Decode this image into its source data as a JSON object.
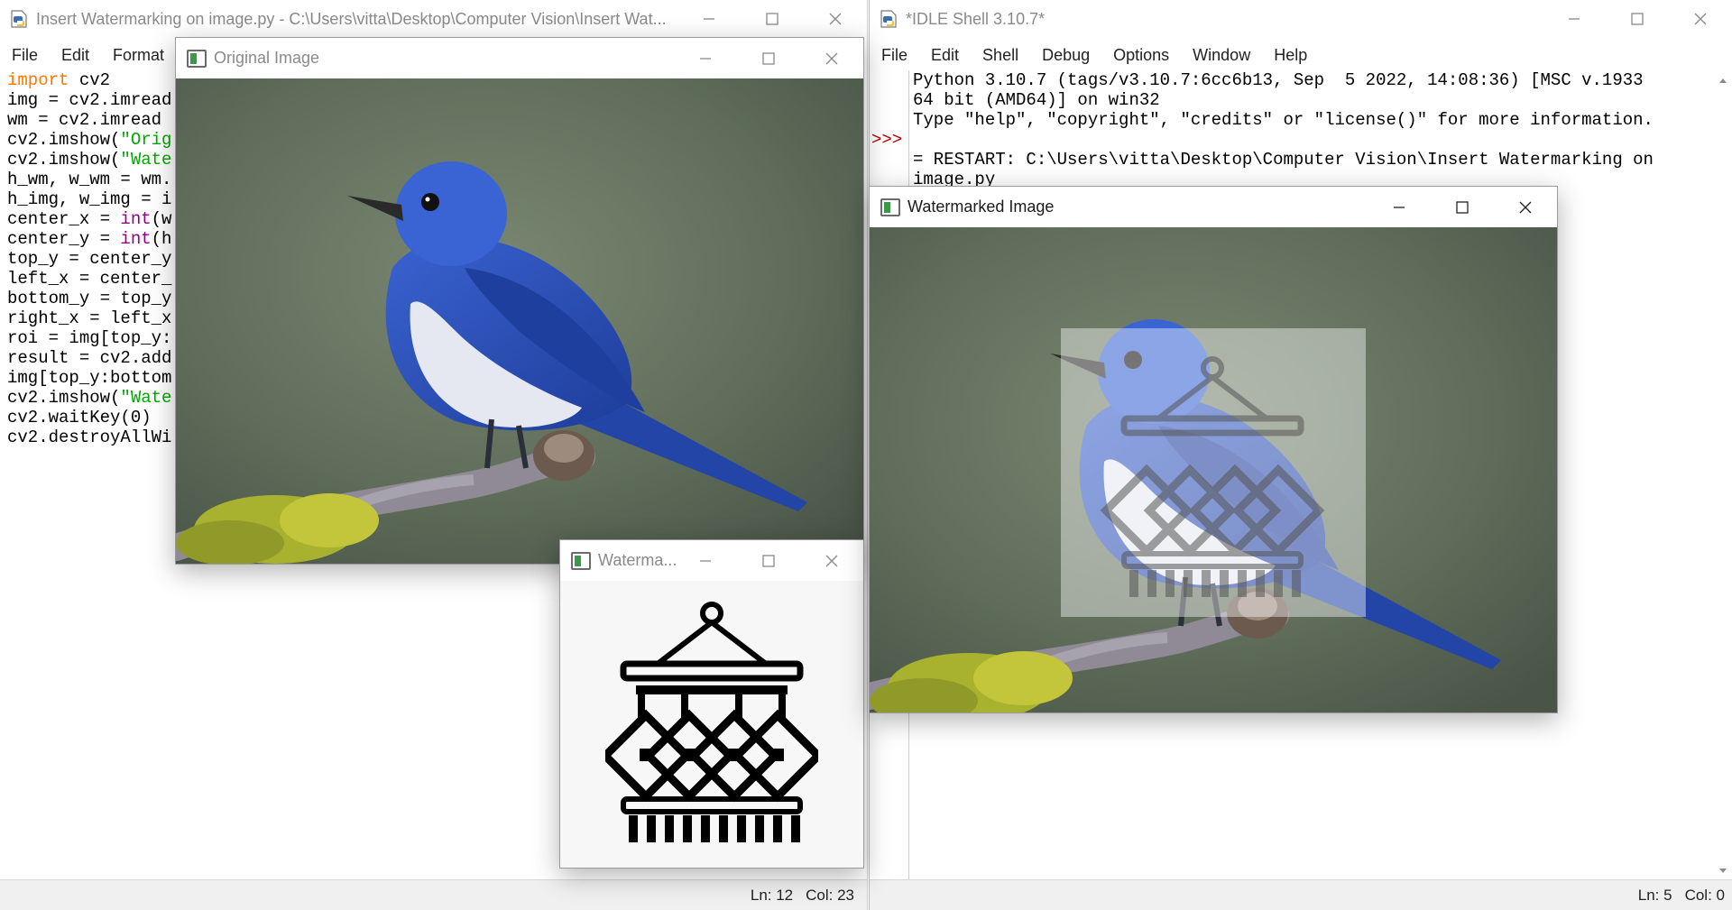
{
  "editor": {
    "title": "Insert Watermarking on image.py - C:\\Users\\vitta\\Desktop\\Computer Vision\\Insert Wat...",
    "menu": [
      "File",
      "Edit",
      "Format"
    ],
    "status_ln": "Ln: 12",
    "status_col": "Col: 23",
    "code_lines": [
      {
        "parts": [
          {
            "t": "import",
            "c": "kw"
          },
          {
            "t": " cv2",
            "c": ""
          }
        ]
      },
      {
        "parts": [
          {
            "t": "img = cv2.imread",
            "c": ""
          }
        ]
      },
      {
        "parts": [
          {
            "t": "wm = cv2.imread",
            "c": ""
          }
        ]
      },
      {
        "parts": [
          {
            "t": "cv2.imshow(",
            "c": ""
          },
          {
            "t": "\"Orig",
            "c": "str"
          }
        ]
      },
      {
        "parts": [
          {
            "t": "cv2.imshow(",
            "c": ""
          },
          {
            "t": "\"Wate",
            "c": "str"
          }
        ]
      },
      {
        "parts": [
          {
            "t": "h_wm, w_wm = wm.",
            "c": ""
          }
        ]
      },
      {
        "parts": [
          {
            "t": "h_img, w_img = i",
            "c": ""
          }
        ]
      },
      {
        "parts": [
          {
            "t": "center_x = ",
            "c": ""
          },
          {
            "t": "int",
            "c": "bi"
          },
          {
            "t": "(w",
            "c": ""
          }
        ]
      },
      {
        "parts": [
          {
            "t": "center_y = ",
            "c": ""
          },
          {
            "t": "int",
            "c": "bi"
          },
          {
            "t": "(h",
            "c": ""
          }
        ]
      },
      {
        "parts": [
          {
            "t": "top_y = center_y",
            "c": ""
          }
        ]
      },
      {
        "parts": [
          {
            "t": "left_x = center_",
            "c": ""
          }
        ]
      },
      {
        "parts": [
          {
            "t": "bottom_y = top_y",
            "c": ""
          }
        ]
      },
      {
        "parts": [
          {
            "t": "right_x = left_x",
            "c": ""
          }
        ]
      },
      {
        "parts": [
          {
            "t": "roi = img[top_y:",
            "c": ""
          }
        ]
      },
      {
        "parts": [
          {
            "t": "result = cv2.add",
            "c": ""
          }
        ]
      },
      {
        "parts": [
          {
            "t": "img[top_y:bottom",
            "c": ""
          }
        ]
      },
      {
        "parts": [
          {
            "t": "cv2.imshow(",
            "c": ""
          },
          {
            "t": "\"Wate",
            "c": "str"
          }
        ]
      },
      {
        "parts": [
          {
            "t": "cv2.waitKey(0)",
            "c": ""
          }
        ]
      },
      {
        "parts": [
          {
            "t": "cv2.destroyAllWi",
            "c": ""
          }
        ]
      }
    ]
  },
  "original_window": {
    "title": "Original Image"
  },
  "watermark_window": {
    "title": "Waterma..."
  },
  "shell": {
    "title": "*IDLE Shell 3.10.7*",
    "menu": [
      "File",
      "Edit",
      "Shell",
      "Debug",
      "Options",
      "Window",
      "Help"
    ],
    "prompt": ">>>",
    "lines": [
      "Python 3.10.7 (tags/v3.10.7:6cc6b13, Sep  5 2022, 14:08:36) [MSC v.1933",
      "64 bit (AMD64)] on win32",
      "Type \"help\", \"copyright\", \"credits\" or \"license()\" for more information.",
      "",
      "= RESTART: C:\\Users\\vitta\\Desktop\\Computer Vision\\Insert Watermarking on",
      "image.py"
    ],
    "status_ln": "Ln: 5",
    "status_col": "Col: 0"
  },
  "watermarked_window": {
    "title": "Watermarked Image"
  },
  "colors": {
    "keyword": "#ff7700",
    "builtin": "#900090",
    "string": "#00aa00",
    "prompt": "#c00000",
    "bird_blue": "#2b4fb8",
    "bird_white": "#e8eaf2",
    "moss": "#b0b830"
  },
  "icons": [
    "python-file-icon",
    "opencv-window-icon",
    "minimize-icon",
    "maximize-icon",
    "close-icon",
    "scroll-up-arrow-icon",
    "scroll-down-arrow-icon",
    "macrame-watermark-icon"
  ]
}
